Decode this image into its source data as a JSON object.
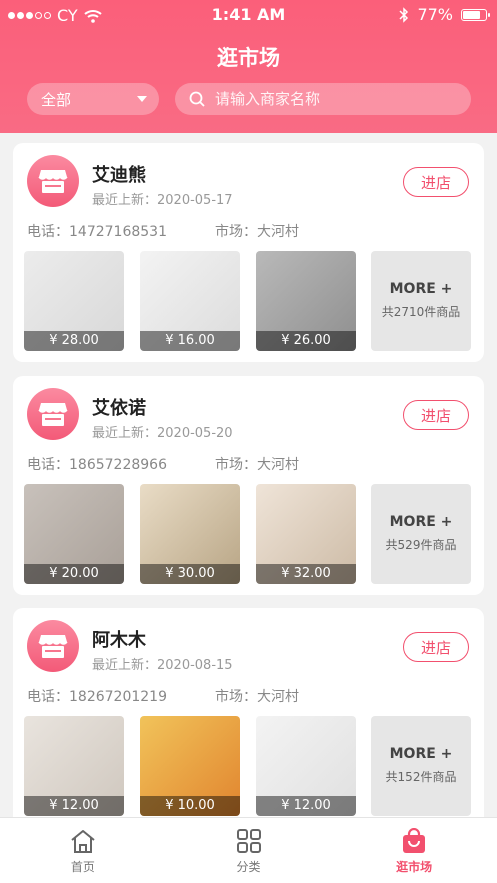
{
  "status_bar": {
    "carrier": "CY",
    "time": "1:41 AM",
    "battery": "77%",
    "battery_level": 0.77
  },
  "header": {
    "title": "逛市场"
  },
  "filter": {
    "value": "全部"
  },
  "search": {
    "placeholder": "请输入商家名称"
  },
  "labels": {
    "phone_prefix": "电话：",
    "market_prefix": "市场：",
    "update_prefix": "最近上新：",
    "enter_button": "进店",
    "more": "MORE +"
  },
  "shops": [
    {
      "name": "艾迪熊",
      "update": "2020-05-17",
      "phone": "14727168531",
      "market": "大河村",
      "products": [
        {
          "price": "¥ 28.00"
        },
        {
          "price": "¥ 16.00"
        },
        {
          "price": "¥ 26.00"
        }
      ],
      "more_count": "共2710件商品"
    },
    {
      "name": "艾依诺",
      "update": "2020-05-20",
      "phone": "18657228966",
      "market": "大河村",
      "products": [
        {
          "price": "¥ 20.00"
        },
        {
          "price": "¥ 30.00"
        },
        {
          "price": "¥ 32.00"
        }
      ],
      "more_count": "共529件商品"
    },
    {
      "name": "阿木木",
      "update": "2020-08-15",
      "phone": "18267201219",
      "market": "大河村",
      "products": [
        {
          "price": "¥ 12.00"
        },
        {
          "price": "¥ 10.00"
        },
        {
          "price": "¥ 12.00"
        }
      ],
      "more_count": "共152件商品"
    }
  ],
  "tabs": [
    {
      "label": "首页",
      "icon": "home-icon"
    },
    {
      "label": "分类",
      "icon": "grid-icon"
    },
    {
      "label": "逛市场",
      "icon": "shopping-bag-icon",
      "active": true
    }
  ],
  "colors": {
    "brand": "#f2506e",
    "header": "#fb5f7a"
  }
}
